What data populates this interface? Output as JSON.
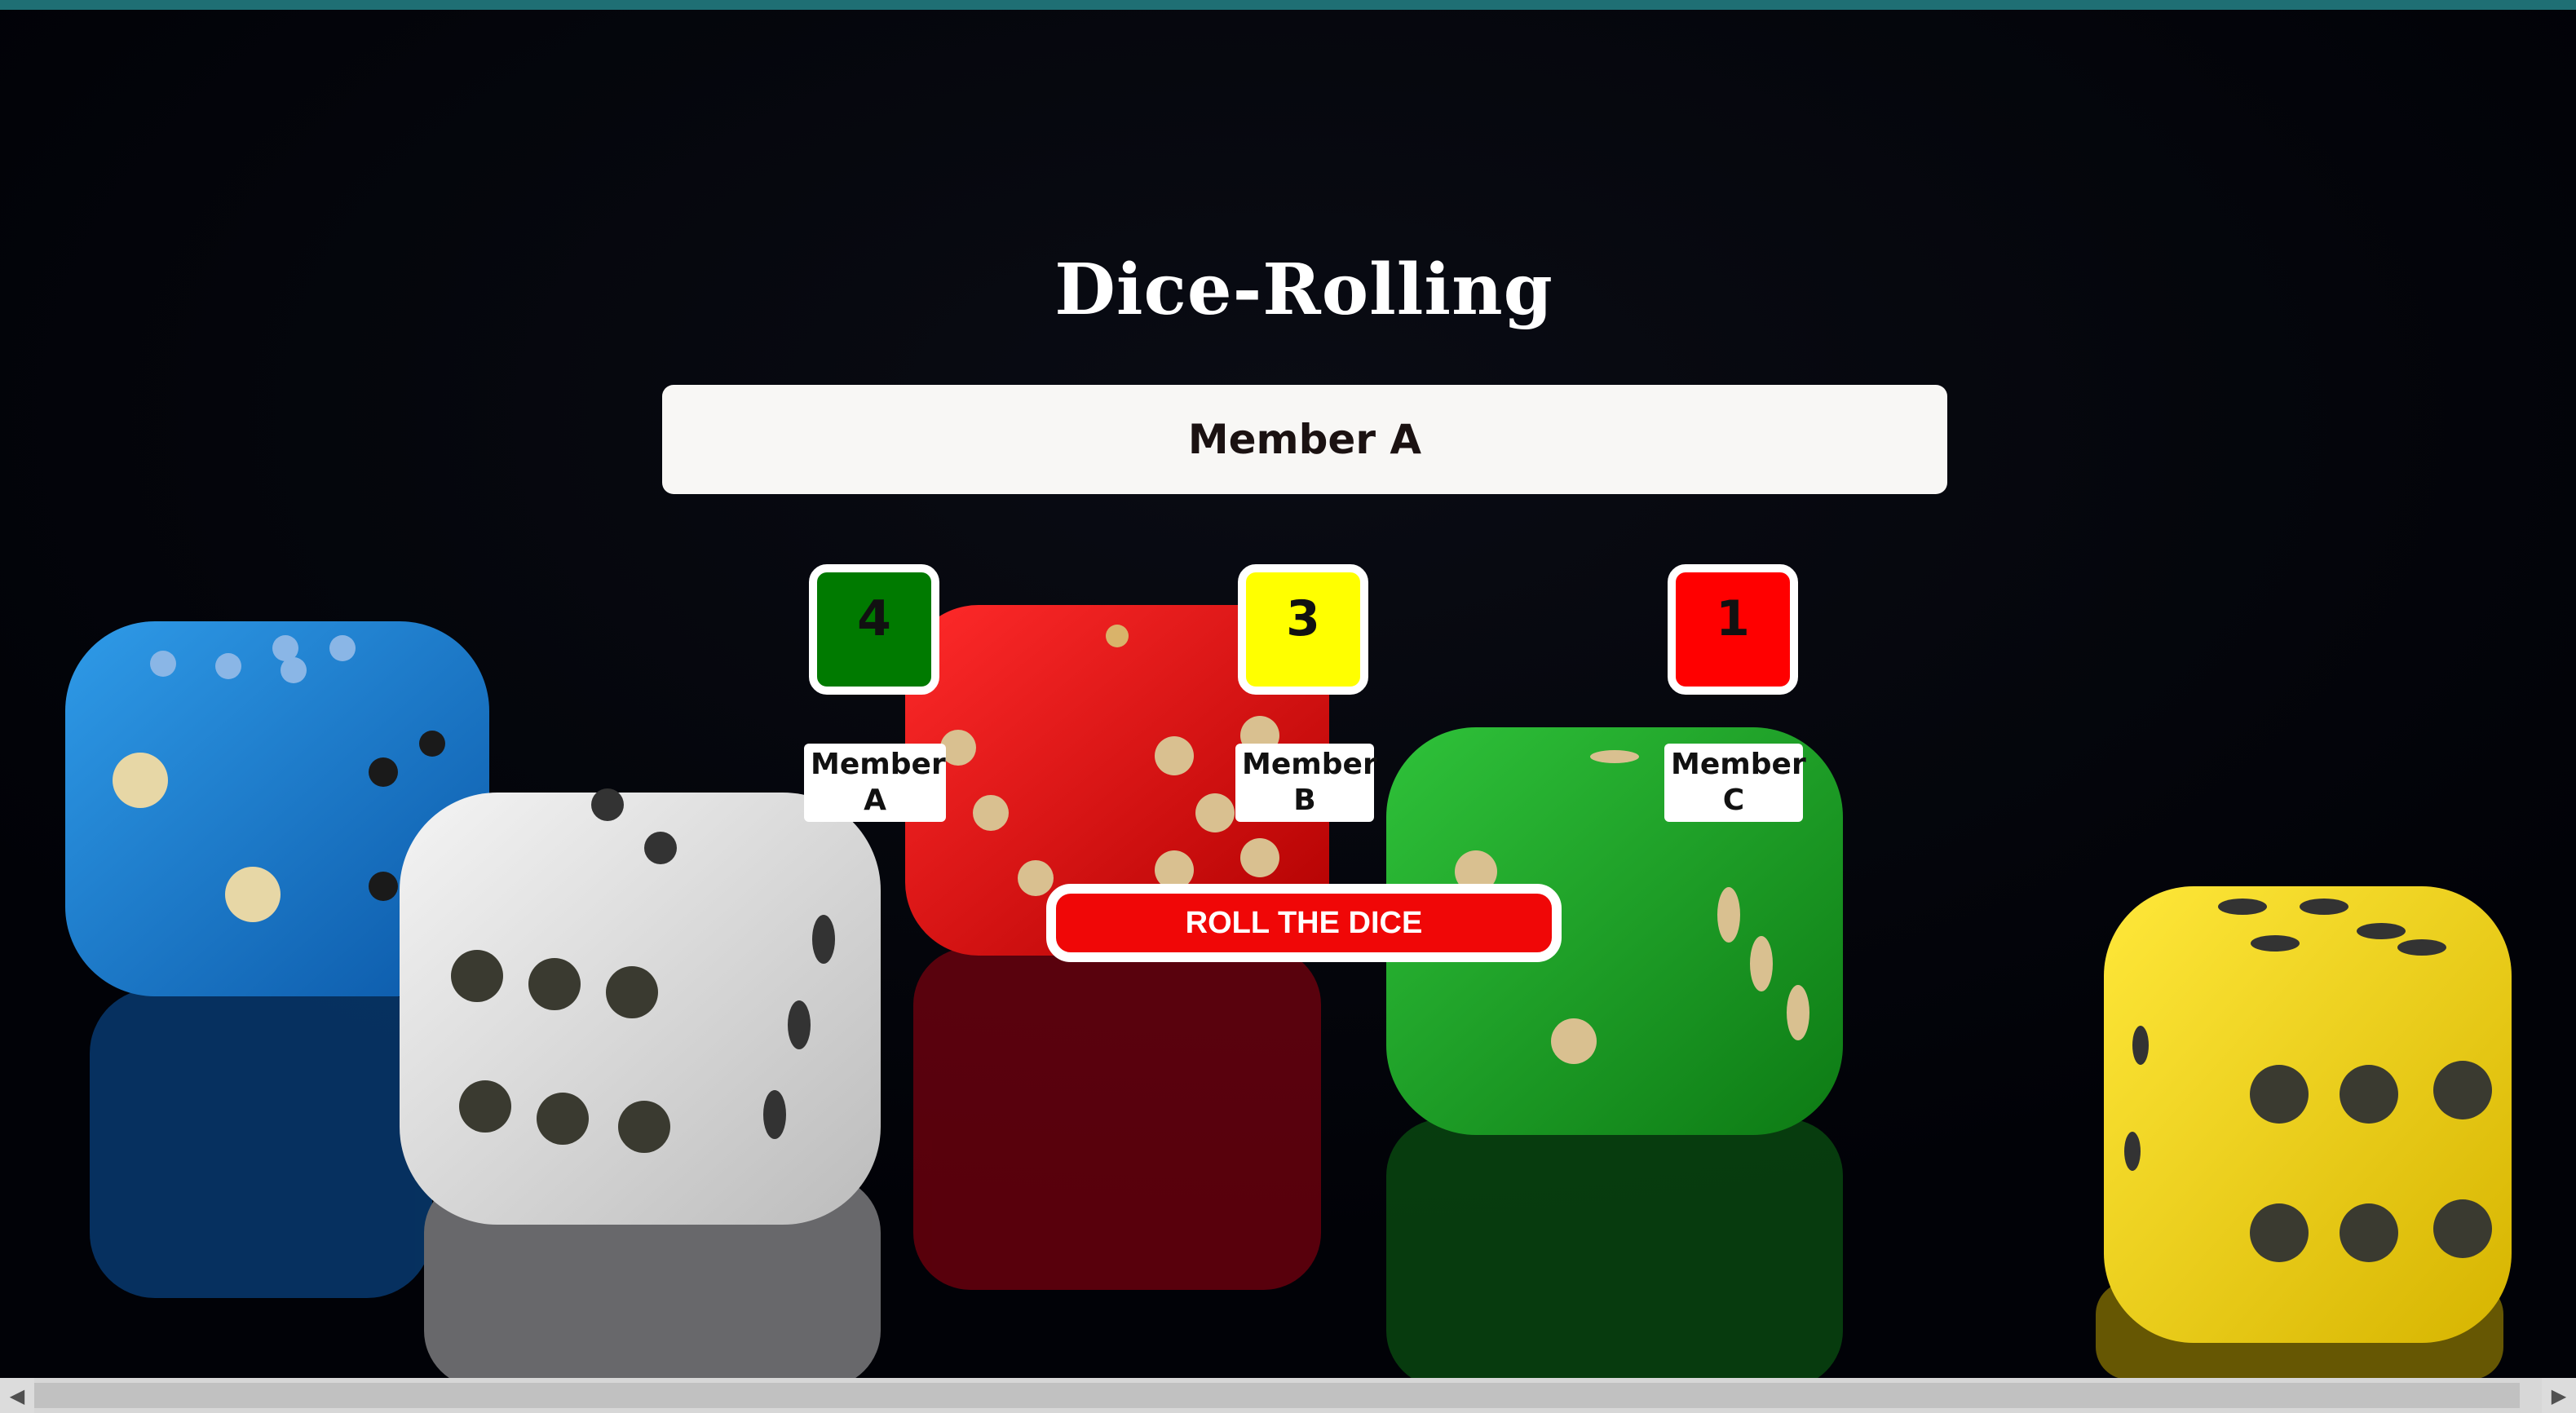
{
  "title": "Dice-Rolling",
  "current_player": "Member A",
  "players": [
    {
      "name_line1": "Member",
      "name_line2": "A",
      "score": "4",
      "color": "#007a00"
    },
    {
      "name_line1": "Member",
      "name_line2": "B",
      "score": "3",
      "color": "#ffff00"
    },
    {
      "name_line1": "Member",
      "name_line2": "C",
      "score": "1",
      "color": "#ff0000"
    }
  ],
  "roll_button_label": "ROLL THE DICE",
  "scrollbar": {
    "left_arrow": "◀",
    "right_arrow": "▶"
  },
  "background_image": "photo of colored dice (blue, white, red, green, yellow) on black reflective surface",
  "colors": {
    "top_bar": "#1f6f74",
    "button": "#f00707"
  }
}
